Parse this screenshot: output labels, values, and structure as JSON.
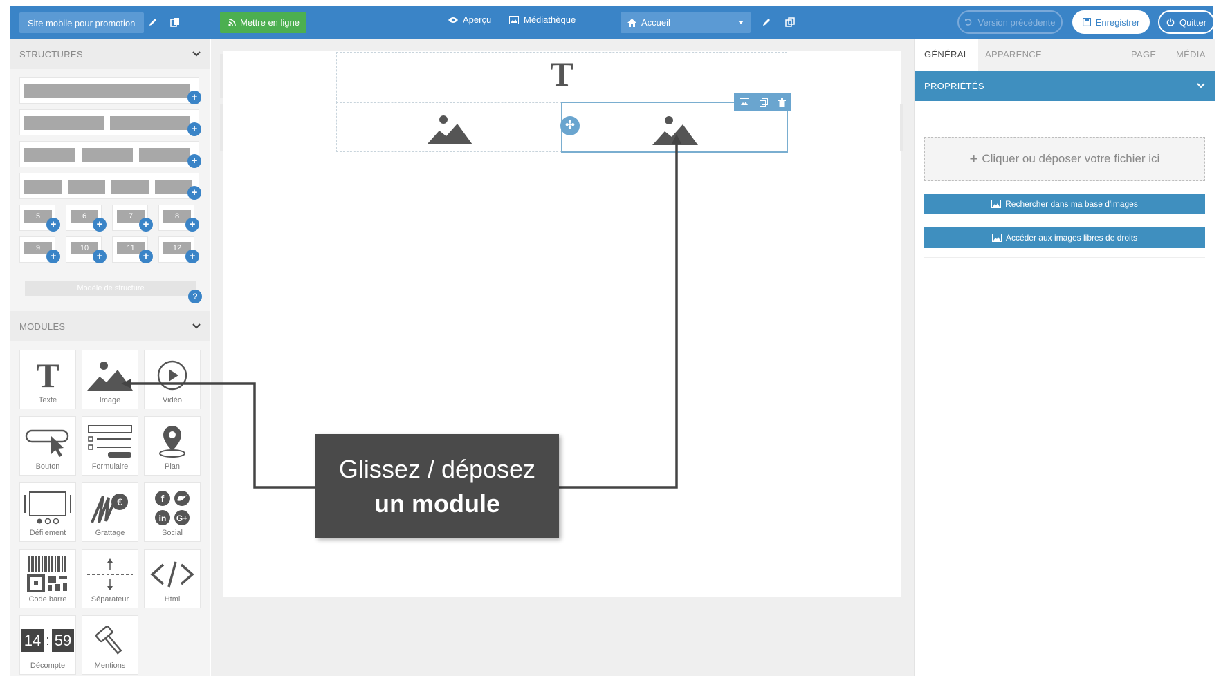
{
  "topbar": {
    "site_name": "Site mobile pour promotion",
    "publish_label": "Mettre en ligne",
    "preview_label": "Aperçu",
    "media_label": "Médiathèque",
    "page_select": "Accueil",
    "previous_version_label": "Version précédente",
    "save_label": "Enregistrer",
    "quit_label": "Quitter",
    "accent_color": "#3a84c7",
    "publish_color": "#4caf50"
  },
  "structures": {
    "title": "STRUCTURES",
    "grid_numbers": [
      "5",
      "6",
      "7",
      "8",
      "9",
      "10",
      "11",
      "12"
    ],
    "model_label": "Modèle de structure",
    "help": "?"
  },
  "modules": {
    "title": "MODULES",
    "items": [
      {
        "label": "Texte",
        "icon": "text-icon"
      },
      {
        "label": "Image",
        "icon": "image-icon"
      },
      {
        "label": "Vidéo",
        "icon": "video-icon"
      },
      {
        "label": "Bouton",
        "icon": "button-icon"
      },
      {
        "label": "Formulaire",
        "icon": "form-icon"
      },
      {
        "label": "Plan",
        "icon": "map-pin-icon"
      },
      {
        "label": "Défilement",
        "icon": "slider-icon"
      },
      {
        "label": "Grattage",
        "icon": "scratch-icon"
      },
      {
        "label": "Social",
        "icon": "social-icon"
      },
      {
        "label": "Code barre",
        "icon": "barcode-icon"
      },
      {
        "label": "Séparateur",
        "icon": "separator-icon"
      },
      {
        "label": "Html",
        "icon": "code-icon"
      },
      {
        "label": "Décompte",
        "icon": "countdown-icon"
      },
      {
        "label": "Mentions",
        "icon": "gavel-icon"
      }
    ],
    "countdown": {
      "h": "14",
      "sep": ":",
      "m": "59"
    }
  },
  "canvas": {
    "text_block_glyph": "T",
    "move_handle": "✣"
  },
  "callout": {
    "line1": "Glissez / déposez",
    "line2": "un module"
  },
  "right_panel": {
    "tabs": [
      "GÉNÉRAL",
      "APPARENCE",
      "PAGE",
      "MÉDIA"
    ],
    "properties_title": "PROPRIÉTÉS",
    "dropzone_text": "Cliquer ou déposer votre fichier ici",
    "dropzone_plus": "+",
    "search_button": "Rechercher dans ma base d'images",
    "free_images_button": "Accéder aux images libres de droits"
  }
}
